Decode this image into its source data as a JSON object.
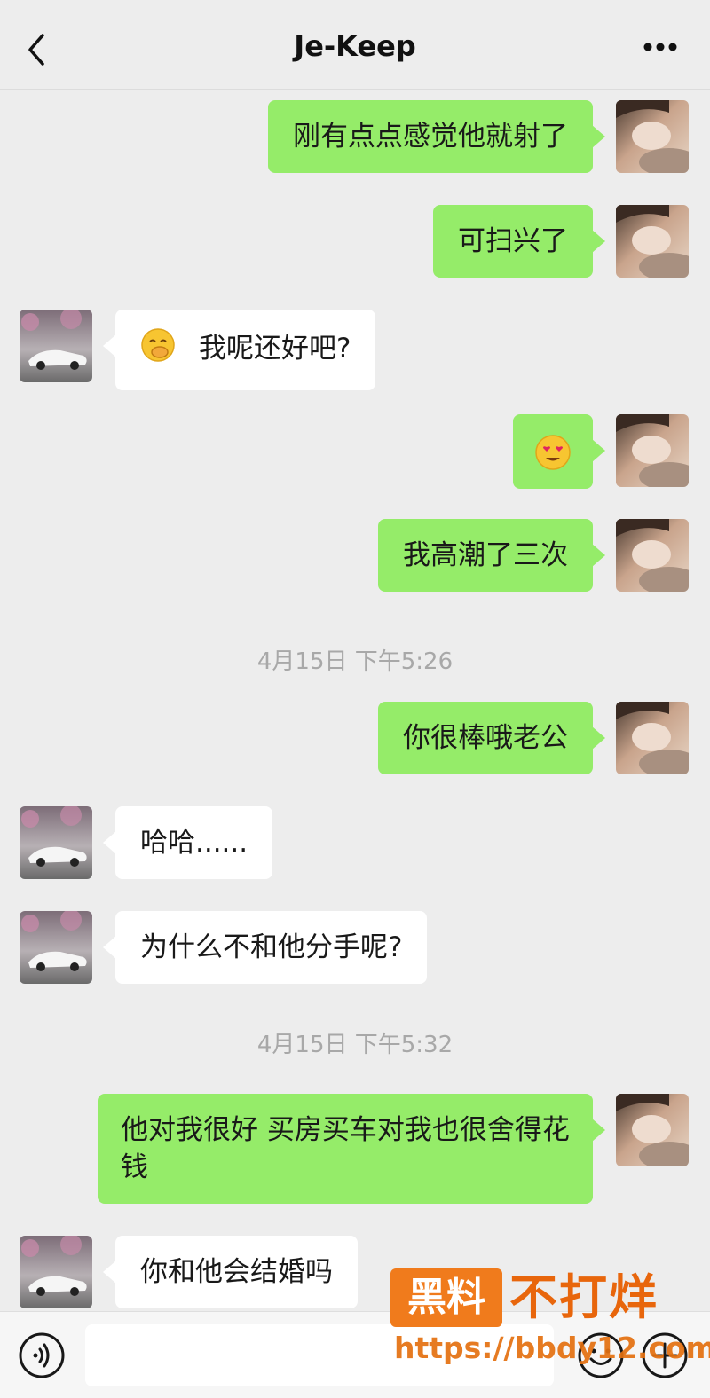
{
  "header": {
    "title": "Je-Keep"
  },
  "messages": [
    {
      "side": "me",
      "text": "刚有点点感觉他就射了"
    },
    {
      "side": "me",
      "text": "可扫兴了"
    },
    {
      "side": "them",
      "emoji": "🤭",
      "text": "我呢还好吧?"
    },
    {
      "side": "me",
      "emoji": "😍"
    },
    {
      "side": "me",
      "text": "我高潮了三次"
    },
    {
      "side": "me",
      "text": "你很棒哦老公"
    },
    {
      "side": "them",
      "text": "哈哈......"
    },
    {
      "side": "them",
      "text": "为什么不和他分手呢?"
    },
    {
      "side": "me",
      "text": "他对我很好  买房买车对我也很舍得花钱"
    },
    {
      "side": "them",
      "text": "你和他会结婚吗"
    }
  ],
  "timestamps": [
    "4月15日 下午5:26",
    "4月15日 下午5:32"
  ],
  "watermark": {
    "badge": "黑料",
    "text": "不打烊",
    "url": "https://bbdy12.com"
  },
  "colors": {
    "my_bubble": "#95ec69",
    "their_bubble": "#ffffff",
    "background": "#ededed",
    "watermark": "#f07b1c"
  }
}
